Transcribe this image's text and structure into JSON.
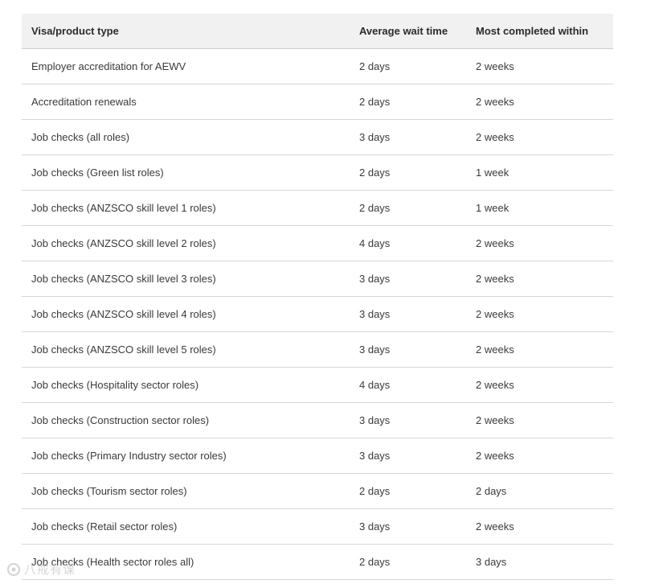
{
  "table": {
    "headers": [
      "Visa/product type",
      "Average wait time",
      "Most completed within"
    ],
    "rows": [
      [
        "Employer accreditation for AEWV",
        "2 days",
        "2 weeks"
      ],
      [
        "Accreditation renewals",
        "2 days",
        "2 weeks"
      ],
      [
        "Job checks (all roles)",
        "3 days",
        "2 weeks"
      ],
      [
        "Job checks (Green list roles)",
        "2 days",
        "1 week"
      ],
      [
        "Job checks (ANZSCO skill level 1 roles)",
        "2 days",
        "1 week"
      ],
      [
        "Job checks (ANZSCO skill level 2 roles)",
        "4 days",
        "2 weeks"
      ],
      [
        "Job checks (ANZSCO skill level 3 roles)",
        "3 days",
        "2 weeks"
      ],
      [
        "Job checks (ANZSCO skill level 4 roles)",
        "3 days",
        "2 weeks"
      ],
      [
        "Job checks (ANZSCO skill level 5 roles)",
        "3 days",
        "2 weeks"
      ],
      [
        "Job checks (Hospitality sector roles)",
        "4 days",
        "2 weeks"
      ],
      [
        "Job checks (Construction sector roles)",
        "3 days",
        "2 weeks"
      ],
      [
        "Job checks (Primary Industry sector roles)",
        "3 days",
        "2 weeks"
      ],
      [
        "Job checks (Tourism sector roles)",
        "2 days",
        "2 days"
      ],
      [
        "Job checks (Retail sector roles)",
        "3 days",
        "2 weeks"
      ],
      [
        "Job checks (Health sector roles all)",
        "2 days",
        "3 days"
      ]
    ]
  },
  "watermark": {
    "icon": "watermark-logo-icon",
    "text": "八戒有课"
  }
}
